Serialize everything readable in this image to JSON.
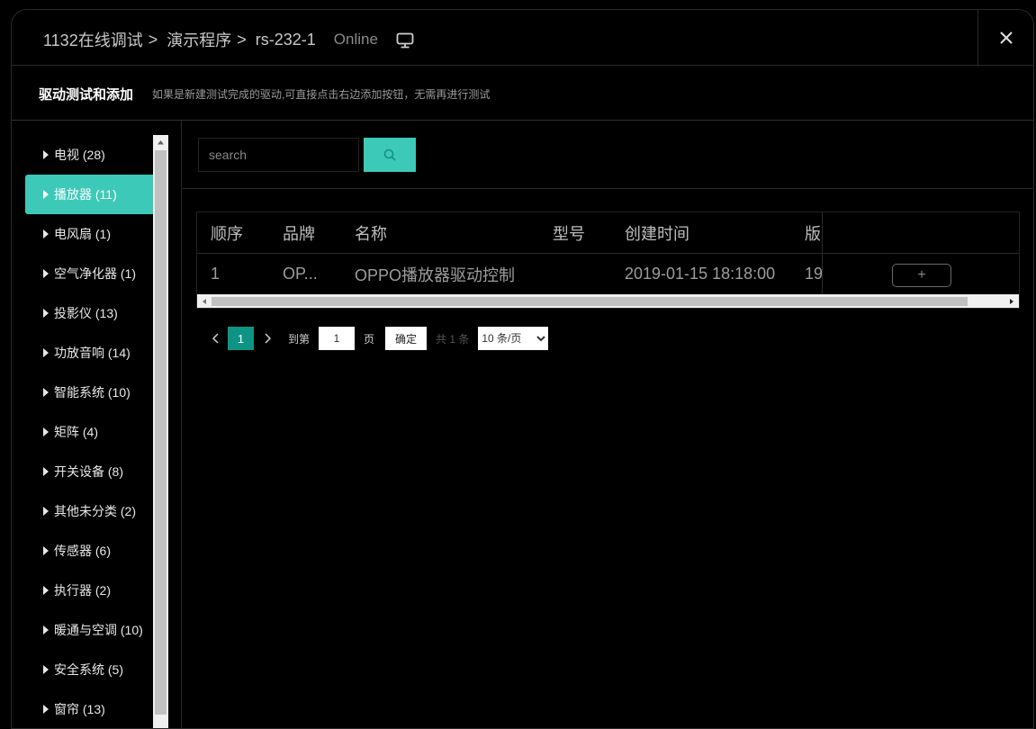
{
  "header": {
    "breadcrumbs": [
      "1132在线调试",
      "演示程序",
      "rs-232-1"
    ],
    "status": "Online"
  },
  "subheader": {
    "title": "驱动测试和添加",
    "hint": "如果是新建测试完成的驱动,可直接点击右边添加按钮，无需再进行测试"
  },
  "sidebar": {
    "categories": [
      "电视 (28)",
      "播放器 (11)",
      "电风扇 (1)",
      "空气净化器 (1)",
      "投影仪 (13)",
      "功放音响 (14)",
      "智能系统 (10)",
      "矩阵 (4)",
      "开关设备 (8)",
      "其他未分类 (2)",
      "传感器 (6)",
      "执行器 (2)",
      "暖通与空调 (10)",
      "安全系统 (5)",
      "窗帘 (13)"
    ],
    "active_index": 1
  },
  "search": {
    "placeholder": "search"
  },
  "table": {
    "columns": [
      "顺序",
      "品牌",
      "名称",
      "型号",
      "创建时间",
      "版"
    ],
    "rows": [
      {
        "order": "1",
        "brand": "OP...",
        "name": "OPPO播放器驱动控制",
        "model": "",
        "created": "2019-01-15 18:18:00",
        "version": "19"
      }
    ],
    "add_label": "+"
  },
  "pagination": {
    "current_page": "1",
    "goto_label": "到第",
    "goto_value": "1",
    "page_unit": "页",
    "confirm": "确定",
    "total": "共 1 条",
    "page_size": "10 条/页"
  },
  "colors": {
    "accent": "#3cc9b8",
    "page_active": "#0e9485"
  }
}
